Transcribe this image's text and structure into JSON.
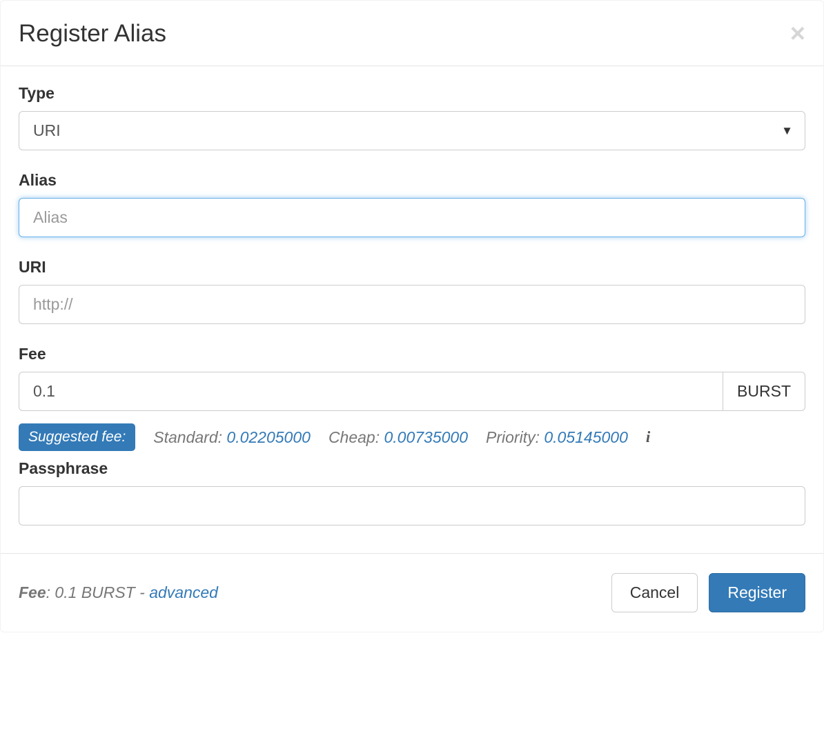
{
  "modal": {
    "title": "Register Alias"
  },
  "form": {
    "type": {
      "label": "Type",
      "selected": "URI"
    },
    "alias": {
      "label": "Alias",
      "placeholder": "Alias",
      "value": ""
    },
    "uri": {
      "label": "URI",
      "placeholder": "http://",
      "value": ""
    },
    "fee": {
      "label": "Fee",
      "value": "0.1",
      "unit": "BURST"
    },
    "suggestions": {
      "badge": "Suggested fee:",
      "standard": {
        "label": "Standard: ",
        "value": "0.02205000"
      },
      "cheap": {
        "label": "Cheap: ",
        "value": "0.00735000"
      },
      "priority": {
        "label": "Priority: ",
        "value": "0.05145000"
      }
    },
    "passphrase": {
      "label": "Passphrase",
      "value": ""
    }
  },
  "footer": {
    "fee_label": "Fee",
    "fee_colon": ": ",
    "fee_amount": "0.1 BURST",
    "dash": " - ",
    "advanced": "advanced",
    "cancel": "Cancel",
    "register": "Register"
  }
}
